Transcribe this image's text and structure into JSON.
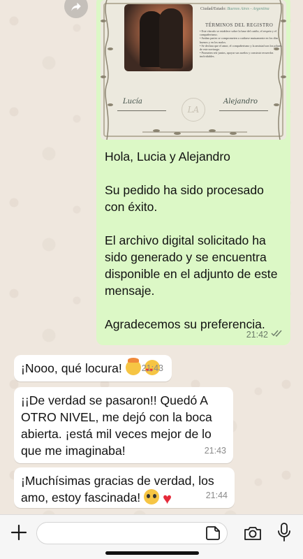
{
  "certificate": {
    "city_label": "Ciudad/Estado:",
    "city_value": "Buenos Aires - Argentina",
    "terms_title": "TÉRMINOS DEL REGISTRO",
    "terms": [
      "Este vínculo se establece sobre la base del cariño, el respeto y el compañerismo.",
      "Ambas partes se comprometen a cuidarse mutuamente en los días buenos y en los malos.",
      "Se declara que el amor, el compañerismo y la amistad son los pilares de este noviazgo.",
      "Prometen reír juntos, apoyar sus sueños y construir recuerdos inolvidables."
    ],
    "sign_left": "Lucía",
    "sign_right": "Alejandro",
    "monogram": "LA"
  },
  "outgoing": {
    "paragraphs": [
      "Hola, Lucia y Alejandro",
      "Su pedido ha sido procesado con éxito.",
      "El archivo digital solicitado ha sido generado y se encuentra disponible en el adjunto de este mensaje.",
      "Agradecemos su preferencia."
    ],
    "time": "21:42",
    "status": "read"
  },
  "incoming": [
    {
      "text": "¡Nooo, qué locura!",
      "time": "21:43"
    },
    {
      "text": "¡¡De verdad se pasaron!! Quedó A OTRO NIVEL, me dejó con la boca abierta. ¡está mil veces mejor de lo que me imaginaba!",
      "time": "21:43"
    },
    {
      "text": "¡Muchísimas gracias de verdad, los amo, estoy fascinada!",
      "time": "21:44"
    }
  ],
  "input": {
    "placeholder": "",
    "value": ""
  },
  "icons": {
    "forward": "forward-icon",
    "plus": "plus-icon",
    "sticker": "sticker-icon",
    "camera": "camera-icon",
    "mic": "microphone-icon",
    "ticks": "double-check-icon"
  },
  "colors": {
    "outgoing_bubble": "#dcf8c6",
    "incoming_bubble": "#ffffff",
    "chat_background": "#efe7de",
    "read_ticks": "#6b7a68"
  }
}
